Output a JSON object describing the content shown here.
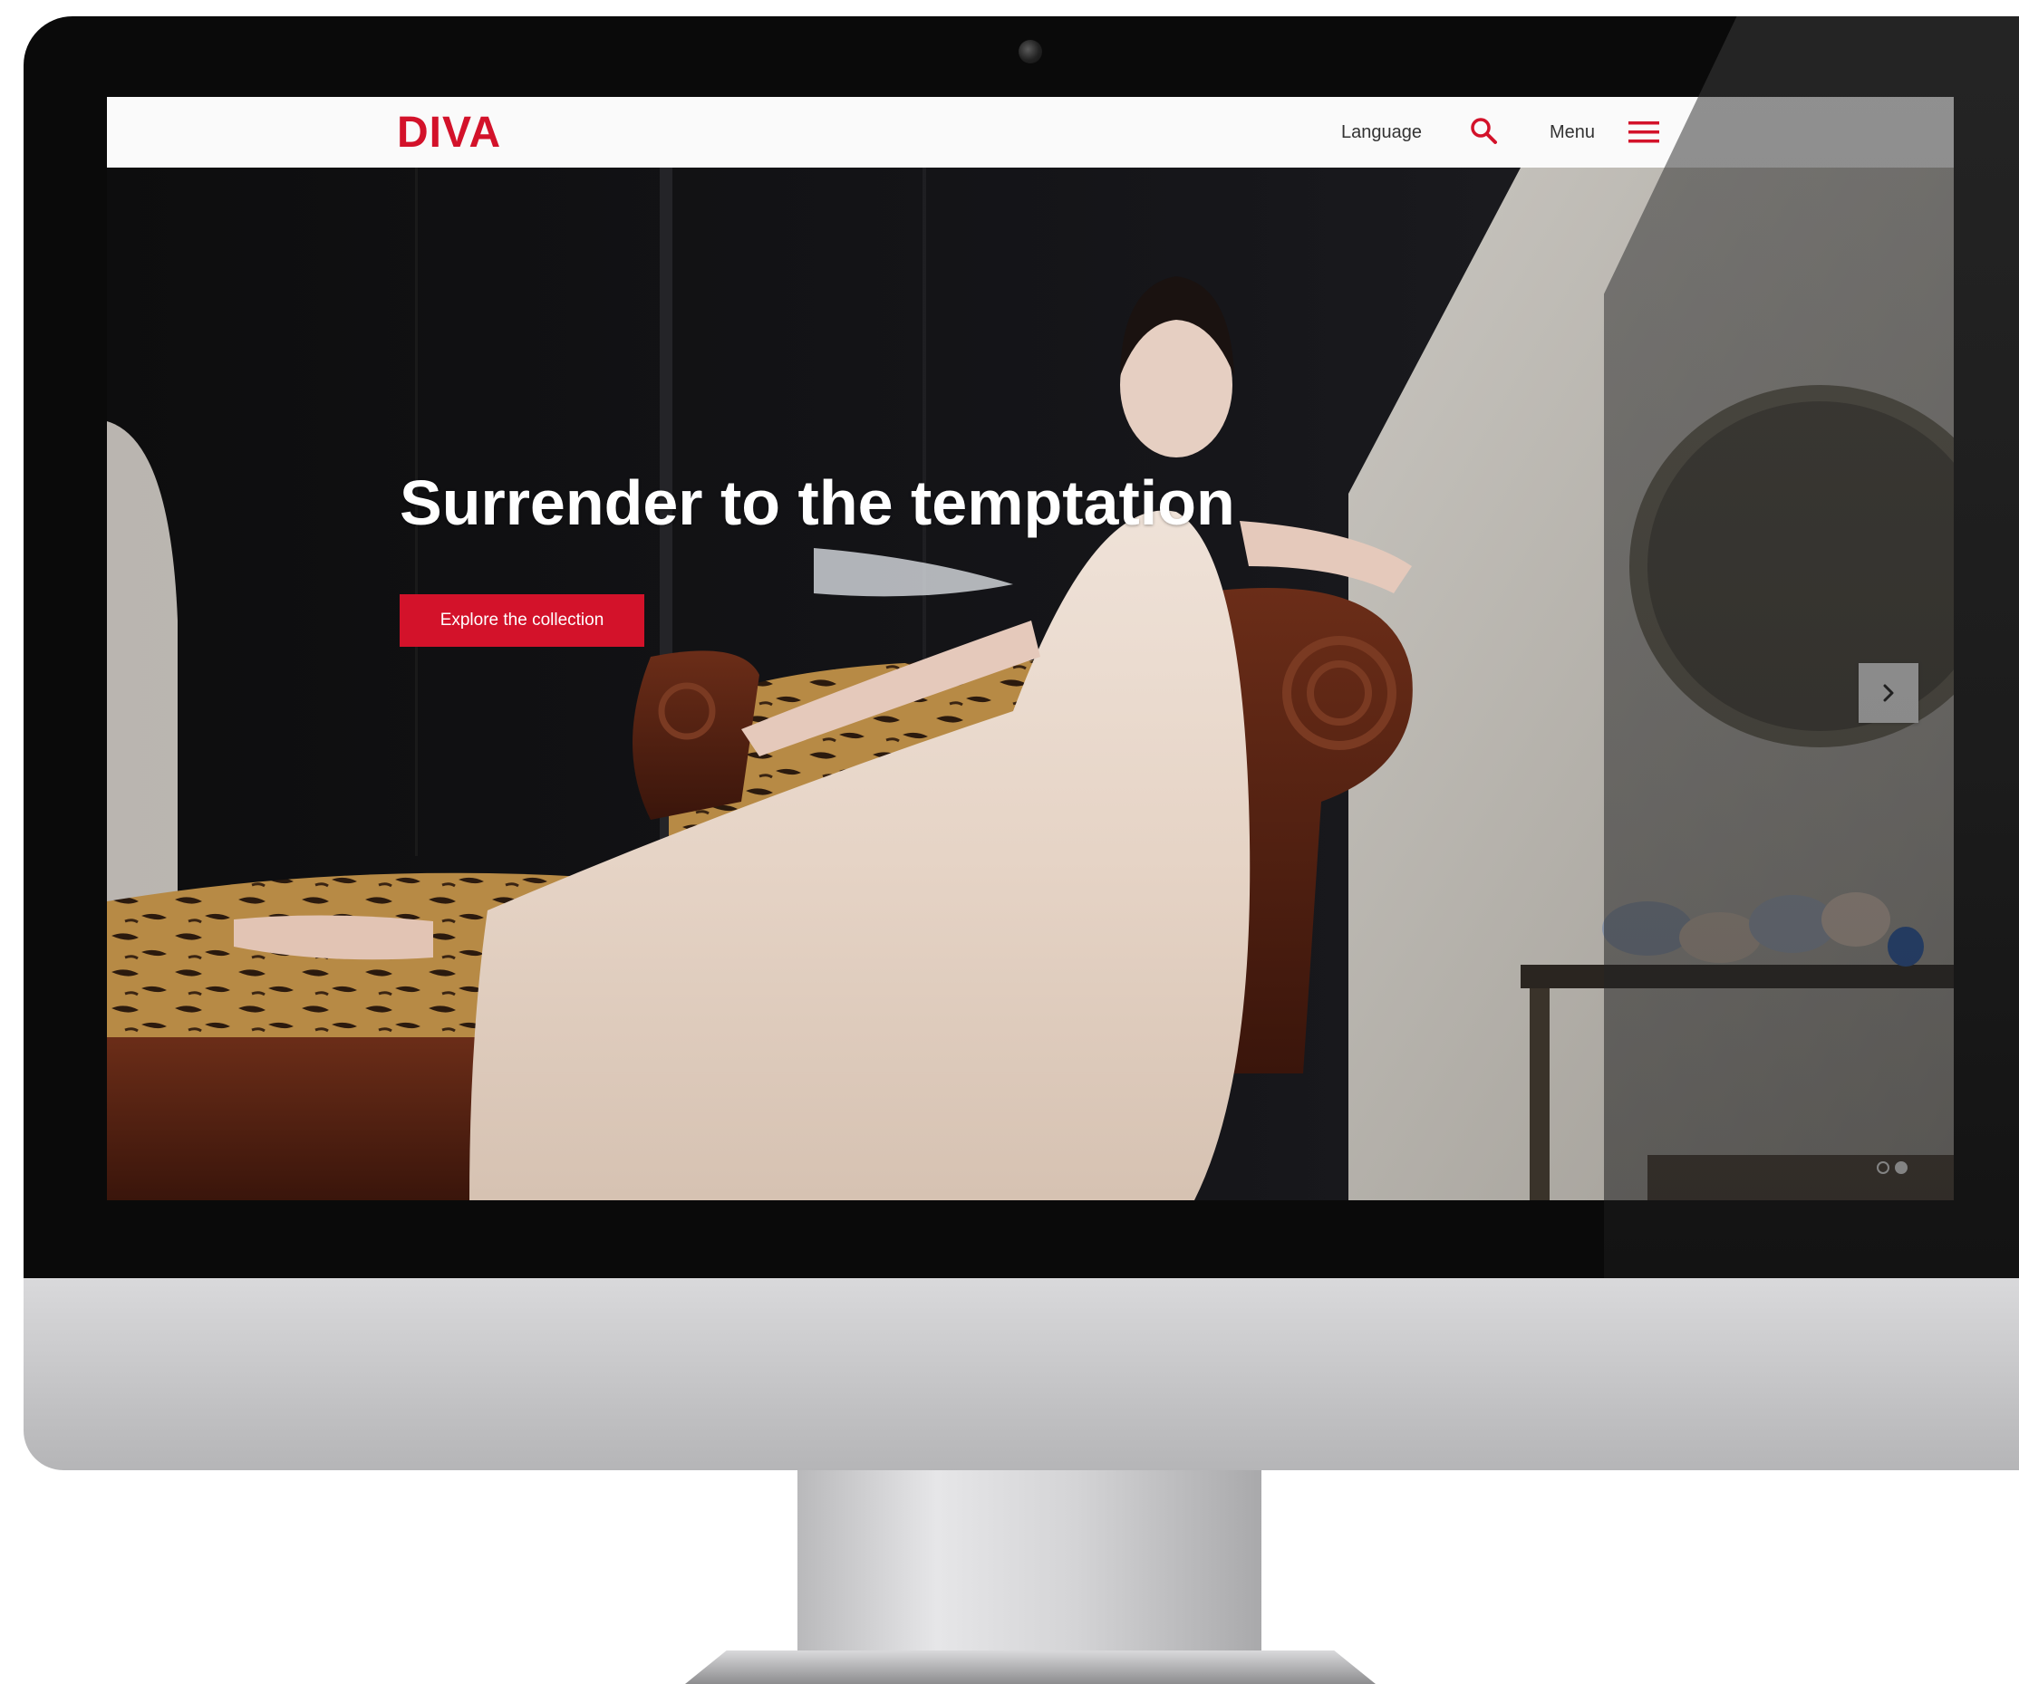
{
  "site": {
    "logo": "DIVA",
    "brand_color": "#d3122a"
  },
  "header": {
    "language_label": "Language",
    "search_icon": "search-icon",
    "menu_label": "Menu",
    "menu_icon": "hamburger-icon"
  },
  "hero": {
    "title": "Surrender to the temptation",
    "cta_label": "Explore the collection",
    "next_icon": "chevron-right-icon",
    "slides_count": 2,
    "active_slide": 2
  },
  "colors": {
    "accent": "#d3122a",
    "header_bg": "#fafafa",
    "hero_text": "#ffffff"
  }
}
